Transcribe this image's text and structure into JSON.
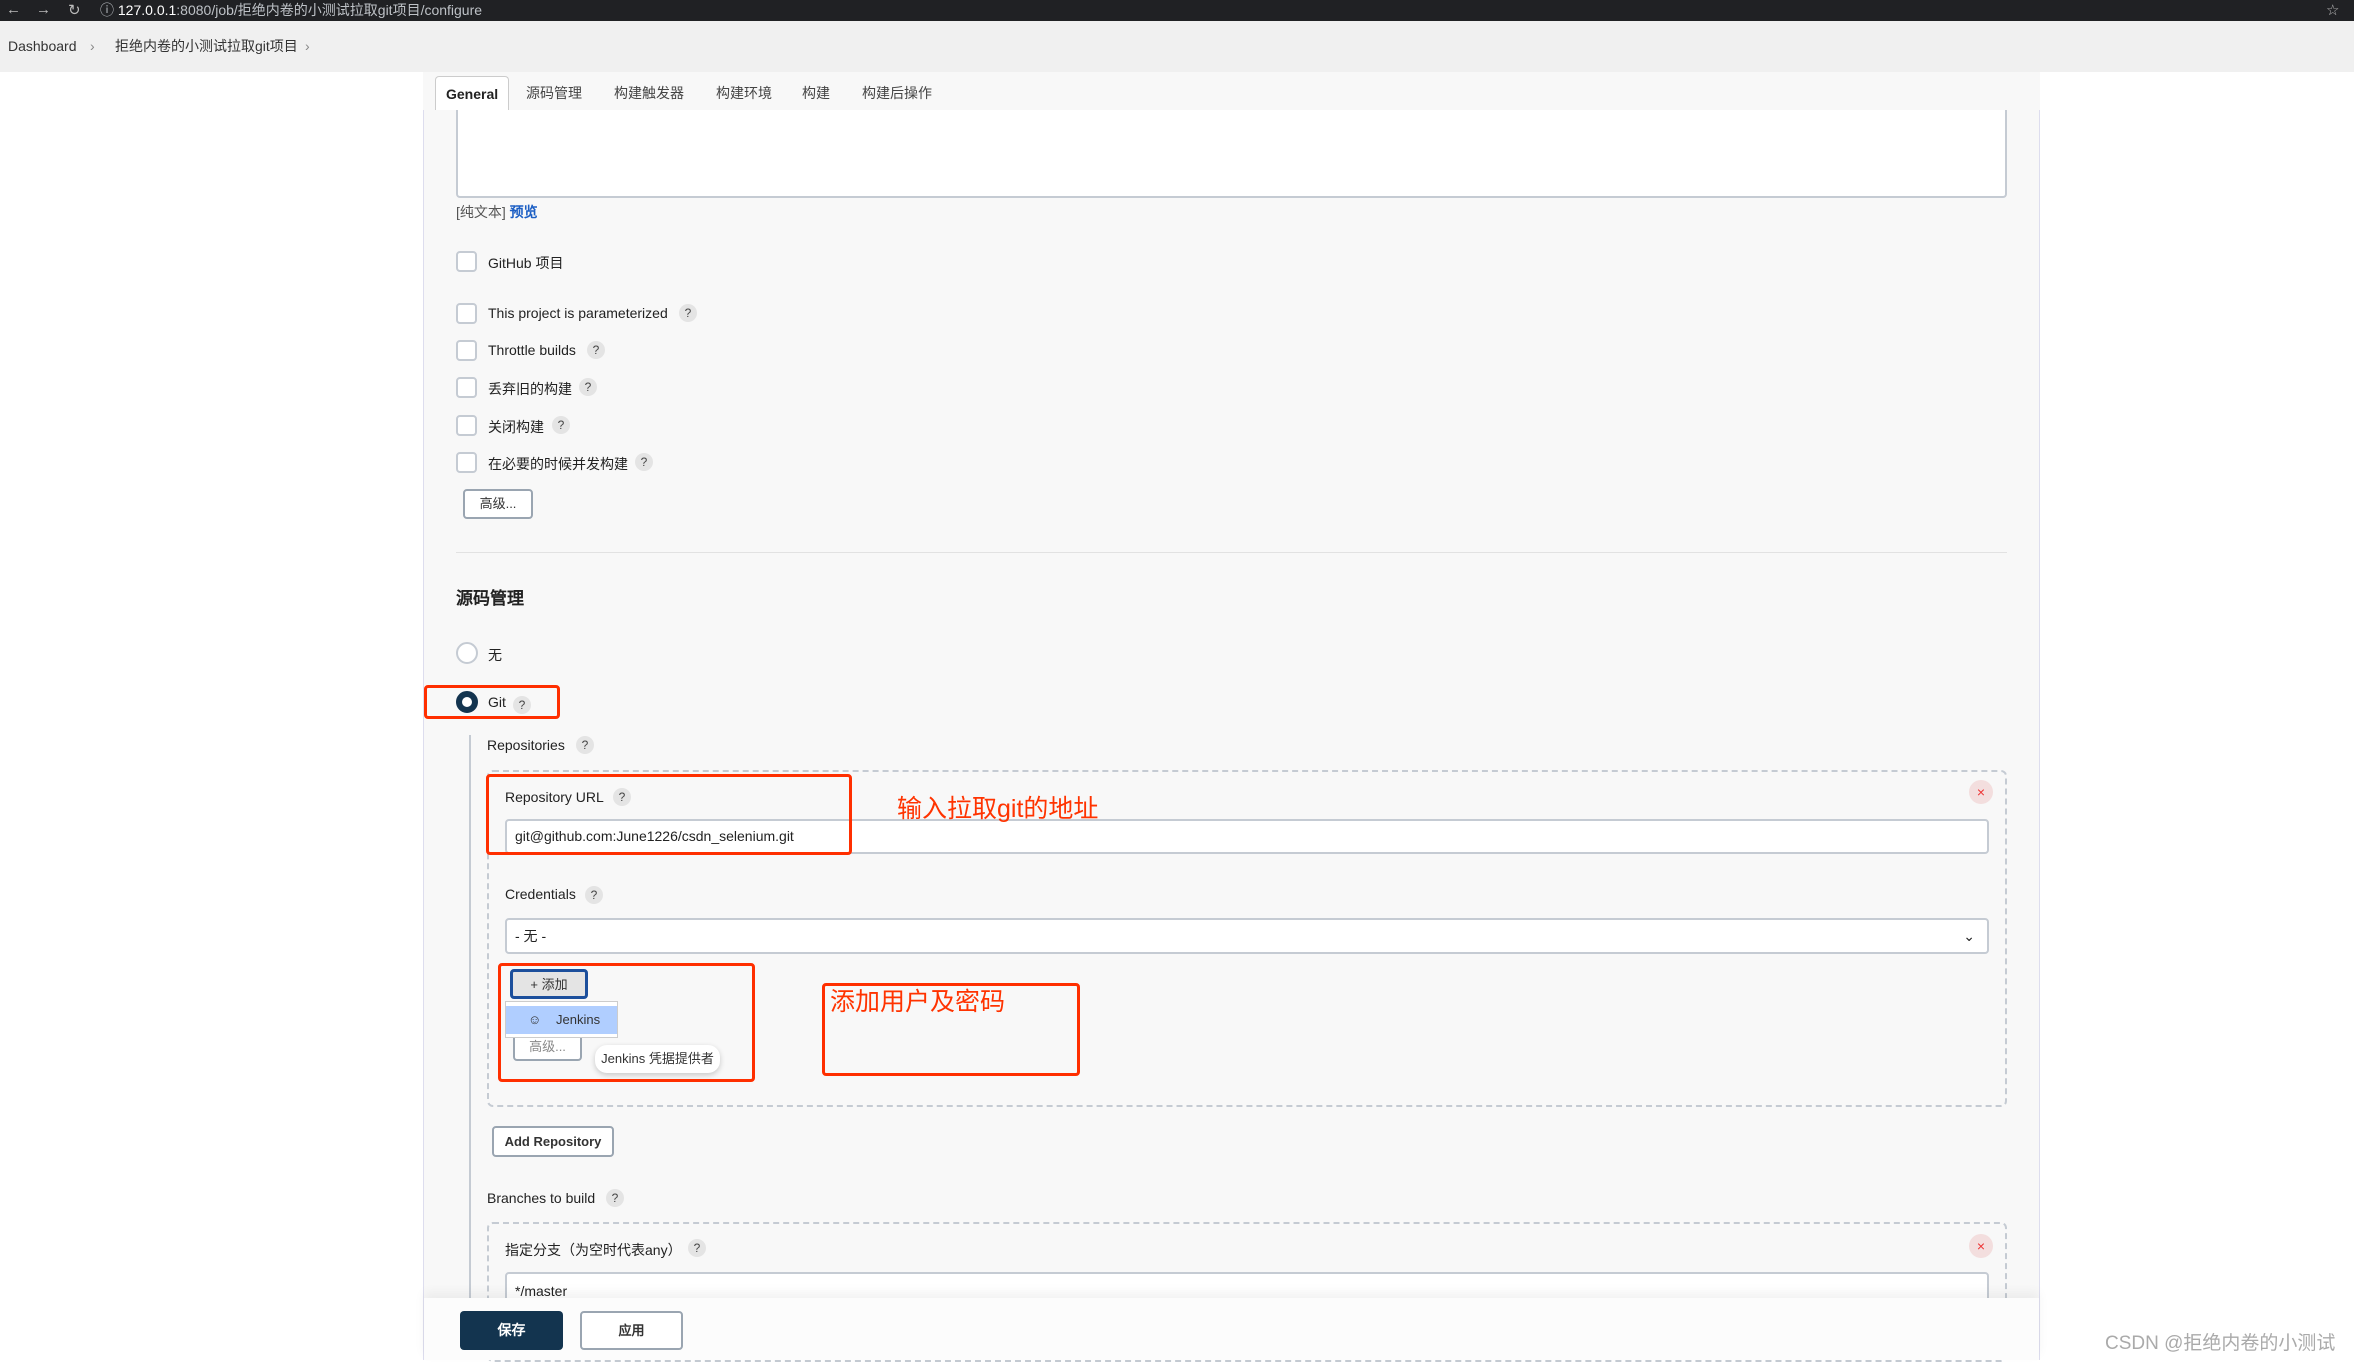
{
  "browser": {
    "url_host": "127.0.0.1",
    "url_rest": ":8080/job/拒绝内卷的小测试拉取git项目/configure"
  },
  "breadcrumb": [
    "Dashboard",
    "拒绝内卷的小测试拉取git项目"
  ],
  "tabs": [
    "General",
    "源码管理",
    "构建触发器",
    "构建环境",
    "构建",
    "构建后操作"
  ],
  "description": {
    "plain_text": "[纯文本]",
    "preview": "预览"
  },
  "options": [
    "GitHub 项目",
    "This project is parameterized",
    "Throttle builds",
    "丢弃旧的构建",
    "关闭构建",
    "在必要的时候并发构建"
  ],
  "advanced_label": "高级...",
  "scm": {
    "heading": "源码管理",
    "none_label": "无",
    "git_label": "Git",
    "repositories_label": "Repositories",
    "repo_url_label": "Repository URL",
    "repo_url_value": "git@github.com:June1226/csdn_selenium.git",
    "credentials_label": "Credentials",
    "credentials_value": "- 无 -",
    "add_label": "添加",
    "dropdown_item": "Jenkins",
    "tooltip": "Jenkins 凭据提供者",
    "add_repository": "Add Repository",
    "branches_label": "Branches to build",
    "branch_spec_label": "指定分支（为空时代表any）",
    "branch_spec_value": "*/master"
  },
  "annotations": {
    "repo_note": "输入拉取git的地址",
    "cred_note": "添加用户及密码"
  },
  "footer": {
    "save": "保存",
    "apply": "应用"
  },
  "watermark": "CSDN @拒绝内卷的小测试",
  "colors": {
    "accent": "#13344f",
    "annotation": "#ff3300"
  }
}
